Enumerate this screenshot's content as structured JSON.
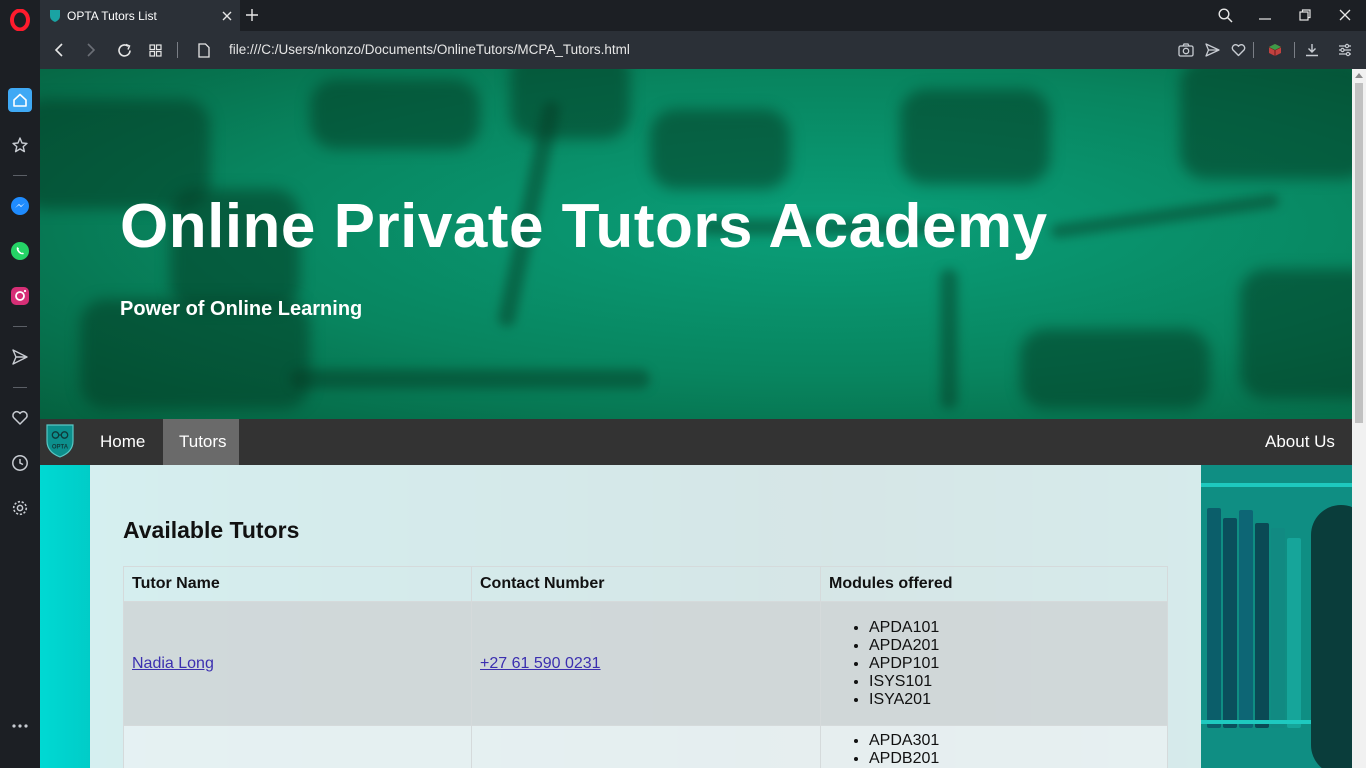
{
  "browser": {
    "tab_title": "OPTA Tutors List",
    "url": "file:///C:/Users/nkonzo/Documents/OnlineTutors/MCPA_Tutors.html"
  },
  "sidebar": {
    "items": [
      {
        "icon": "opera-logo-icon",
        "color": "#ff1b2d"
      },
      {
        "icon": "home-icon",
        "color": "#4aa3ff"
      },
      {
        "icon": "bookmarks-star-icon"
      },
      {
        "icon": "messenger-icon",
        "color": "#1f8cff"
      },
      {
        "icon": "whatsapp-icon",
        "color": "#25d366"
      },
      {
        "icon": "instagram-icon",
        "color": "#e1306c"
      },
      {
        "icon": "send-icon"
      },
      {
        "icon": "heart-icon"
      },
      {
        "icon": "history-clock-icon"
      },
      {
        "icon": "settings-gear-icon"
      },
      {
        "icon": "more-dots-icon"
      }
    ]
  },
  "hero": {
    "title": "Online Private Tutors Academy",
    "subtitle": "Power of Online Learning"
  },
  "nav": {
    "logo_text": "OPTA",
    "home": "Home",
    "tutors": "Tutors",
    "about": "About Us"
  },
  "tutors_section": {
    "title": "Available Tutors",
    "headers": [
      "Tutor Name",
      "Contact Number",
      "Modules offered"
    ],
    "rows": [
      {
        "name": "Nadia Long",
        "contact": "+27 61 590 0231",
        "modules": [
          "APDA101",
          "APDA201",
          "APDP101",
          "ISYS101",
          "ISYA201"
        ]
      },
      {
        "name": "",
        "contact": "",
        "modules": [
          "APDA301",
          "APDB201"
        ]
      }
    ]
  },
  "colors": {
    "hero_green": "#08855f",
    "nav_bar": "#333333",
    "nav_active": "#6a6a6a",
    "link": "#3b2fb0"
  }
}
